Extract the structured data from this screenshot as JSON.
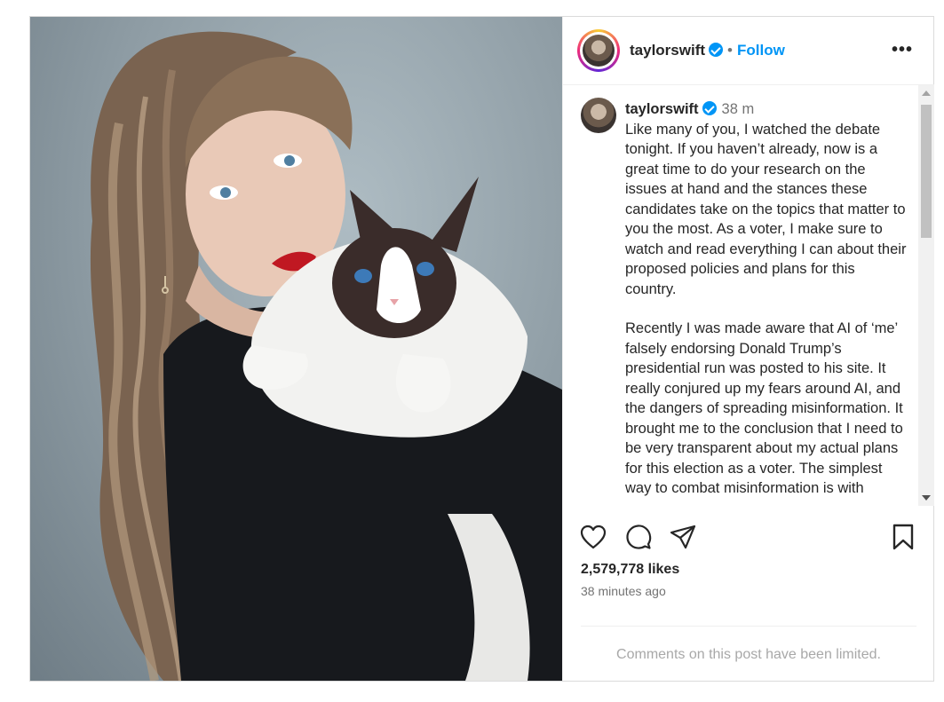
{
  "header": {
    "username": "taylorswift",
    "separator": "•",
    "follow_label": "Follow",
    "more_label": "•••"
  },
  "caption": {
    "username": "taylorswift",
    "time": "38 m",
    "paragraph1": "Like many of you, I watched the debate tonight. If you haven’t already, now is a great time to do your research on the issues at hand and the stances these candidates take on the topics that matter to you the most. As a voter, I make sure to watch and read everything I can about their proposed policies and plans for this country.",
    "paragraph2": "Recently I was made aware that AI of ‘me’ falsely endorsing Donald Trump’s presidential run was posted to his site. It really conjured up my fears around AI, and the dangers of spreading misinformation. It brought me to the conclusion that I need to be very transparent about my actual plans for this election as a voter. The simplest way to combat misinformation is with"
  },
  "icons": {
    "like": "heart-icon",
    "comment": "comment-icon",
    "share": "send-icon",
    "save": "bookmark-icon",
    "verified": "verified-badge-icon",
    "more": "more-options-icon"
  },
  "stats": {
    "likes": "2,579,778 likes",
    "posted": "38 minutes ago"
  },
  "comments_notice": "Comments on this post have been limited.",
  "colors": {
    "accent": "#0095f6",
    "text": "#262626",
    "muted": "#737373",
    "border": "#dbdbdb"
  }
}
